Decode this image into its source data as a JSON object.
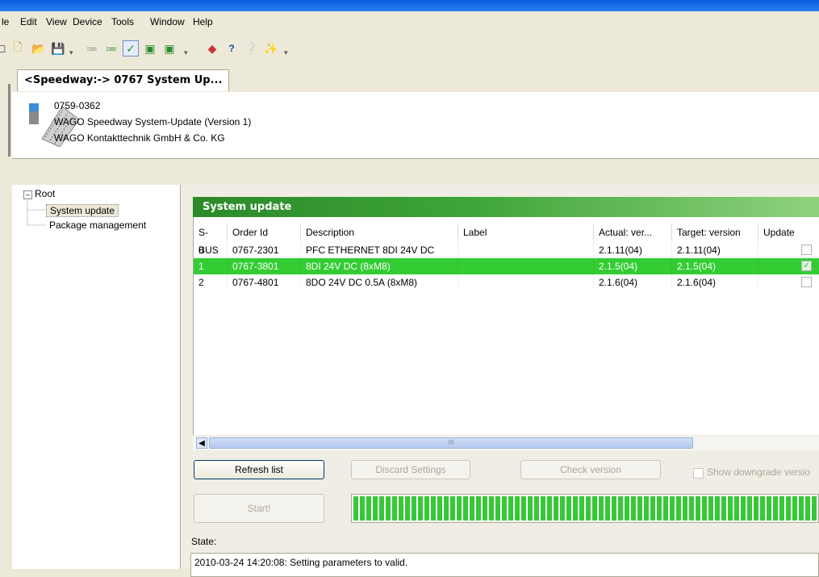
{
  "menu": [
    "le",
    "Edit",
    "View",
    "Device",
    "Tools",
    "Window",
    "Help"
  ],
  "toolbar_icons": [
    "new-doc-icon",
    "new-file-icon",
    "open-folder-icon",
    "save-icon",
    "network-scan-icon",
    "network-config-icon",
    "check-icon",
    "device-upload-icon",
    "device-download-icon",
    "book-icon",
    "help-icon",
    "context-help-icon",
    "tool-icon"
  ],
  "tab": {
    "label": "<Speedway:-> 0767 System Up..."
  },
  "device": {
    "order": "0759-0362",
    "name": "WAGO Speedway System-Update (Version 1)",
    "vendor": "WAGO Kontakttechnik GmbH & Co. KG"
  },
  "tree": {
    "root": "Root",
    "items": [
      "System update",
      "Package management"
    ],
    "selected_index": 0
  },
  "panel": {
    "title": "System update"
  },
  "table": {
    "columns": [
      "S-BUS",
      "Order Id",
      "Description",
      "Label",
      "Actual: ver...",
      "Target: version",
      "Update"
    ],
    "rows": [
      {
        "sbus": "0",
        "order": "0767-2301",
        "desc": "PFC ETHERNET 8DI 24V DC",
        "label": "",
        "actual": "2.1.11(04)",
        "target": "2.1.11(04)",
        "update": false,
        "selected": false
      },
      {
        "sbus": "1",
        "order": "0767-3801",
        "desc": "8DI 24V DC (8xM8)",
        "label": "",
        "actual": "2.1.5(04)",
        "target": "2.1.5(04)",
        "update": true,
        "selected": true
      },
      {
        "sbus": "2",
        "order": "0767-4801",
        "desc": "8DO 24V DC 0.5A (8xM8)",
        "label": "",
        "actual": "2.1.6(04)",
        "target": "2.1.6(04)",
        "update": false,
        "selected": false
      }
    ]
  },
  "scroll_thumb_label": "III",
  "buttons": {
    "refresh": "Refresh list",
    "discard": "Discard Settings",
    "check": "Check version",
    "show_downgrade": "Show downgrade versio",
    "start": "Start!"
  },
  "progress": {
    "percent": 100
  },
  "state": {
    "label": "State:",
    "log": "2010-03-24 14:20:08: Setting parameters to valid."
  },
  "colors": {
    "selected_row": "#33cc33",
    "panel_title": "#3fa53a"
  }
}
